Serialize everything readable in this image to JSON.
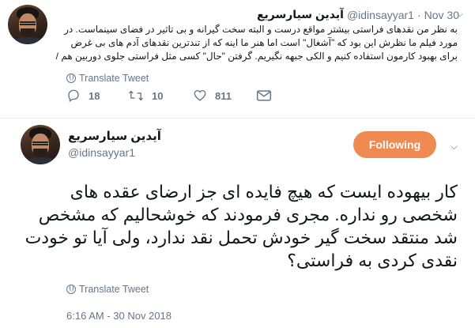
{
  "top_tweet": {
    "name": "آیدین سیارسریع",
    "handle": "@idinsayyar1",
    "separator": "·",
    "date": "Nov 30",
    "text": "به نظر من نقدهای فراستی بیشتر مواقع درست و البته سخت گیرانه و بی تاثیر در فضای سینماست. در مورد فیلم ما نظرش این بود که \"آشغال\" است اما هنر ما اینه که از تندترین نقدهای آدم های بی غرض برای بهبود کارمون استفاده کنیم و الکی جبهه نگیریم. گرفتن \"حال\" کسی مثل فراستی جلوی دوربین هم /",
    "translate_label": "Translate Tweet",
    "replies": "18",
    "retweets": "10",
    "likes": "811"
  },
  "main_tweet": {
    "name": "آیدین سیارسریع",
    "handle": "@idinsayyar1",
    "follow_label": "Following",
    "text": "کار بیهوده ایست که هیچ فایده ای جز ارضای عقده های شخصی رو نداره. مجری فرمودند که خوشحالیم که مشخص شد منتقد سخت گیر خودش تحمل نقد ندارد، ولی آیا تو خودت نقدی کردی به فراستی؟",
    "translate_label": "Translate Tweet",
    "timestamp": "6:16 AM - 30 Nov 2018"
  },
  "icons": {
    "caret": "chevron-down-icon",
    "translate": "globe-icon",
    "reply": "reply-icon",
    "retweet": "retweet-icon",
    "like": "heart-icon",
    "dm": "envelope-icon"
  },
  "colors": {
    "follow_button": "#ee8a52",
    "secondary_text": "#657786",
    "primary_text": "#14171a"
  }
}
